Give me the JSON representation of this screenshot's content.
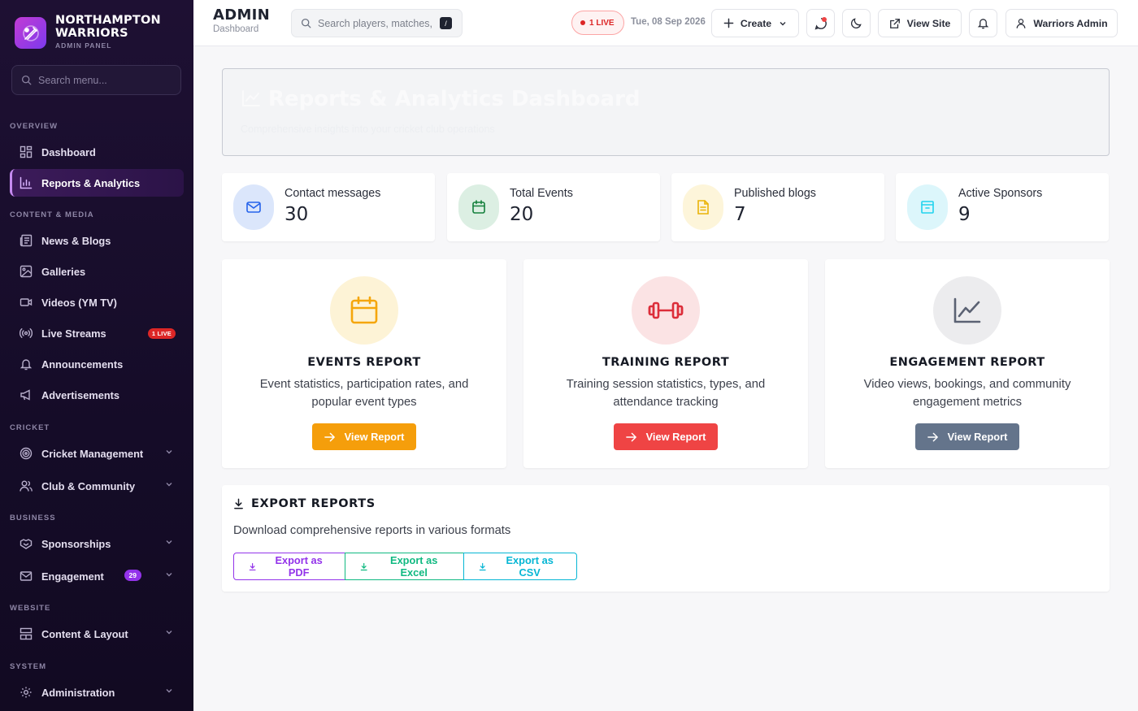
{
  "brand": {
    "title_line1": "NORTHAMPTON",
    "title_line2": "WARRIORS",
    "subtitle": "ADMIN PANEL"
  },
  "sidebar": {
    "search_placeholder": "Search menu...",
    "sections": {
      "overview": "OVERVIEW",
      "content": "CONTENT & MEDIA",
      "cricket": "CRICKET",
      "business": "BUSINESS",
      "website": "WEBSITE",
      "system": "SYSTEM"
    },
    "items": {
      "dashboard": "Dashboard",
      "reports": "Reports & Analytics",
      "news": "News & Blogs",
      "galleries": "Galleries",
      "videos": "Videos (YM TV)",
      "live_streams": "Live Streams",
      "live_badge": "1 LIVE",
      "announcements": "Announcements",
      "advertisements": "Advertisements",
      "cricket_mgmt": "Cricket Management",
      "club": "Club & Community",
      "sponsorships": "Sponsorships",
      "engagement": "Engagement",
      "engagement_badge": "29",
      "content_layout": "Content & Layout",
      "administration": "Administration"
    }
  },
  "topbar": {
    "title": "ADMIN",
    "subtitle": "Dashboard",
    "search_placeholder": "Search players, matches, n",
    "search_shortcut": "/",
    "live_label": "1 LIVE",
    "date": "Tue, 08 Sep 2026",
    "create_label": "Create",
    "view_site_label": "View Site",
    "user_label": "Warriors Admin"
  },
  "hero": {
    "title": "Reports & Analytics Dashboard",
    "subtitle": "Comprehensive insights into your cricket club operations"
  },
  "stats": [
    {
      "label": "Contact messages",
      "value": "30"
    },
    {
      "label": "Total Events",
      "value": "20"
    },
    {
      "label": "Published blogs",
      "value": "7"
    },
    {
      "label": "Active Sponsors",
      "value": "9"
    }
  ],
  "reports": [
    {
      "title": "EVENTS REPORT",
      "description": "Event statistics, participation rates, and popular event types",
      "button": "View Report"
    },
    {
      "title": "TRAINING REPORT",
      "description": "Training session statistics, types, and attendance tracking",
      "button": "View Report"
    },
    {
      "title": "ENGAGEMENT REPORT",
      "description": "Video views, bookings, and community engagement metrics",
      "button": "View Report"
    }
  ],
  "export": {
    "title": "EXPORT REPORTS",
    "description": "Download comprehensive reports in various formats",
    "pdf": "Export as PDF",
    "excel": "Export as Excel",
    "csv": "Export as CSV"
  },
  "colors": {
    "accent_purple": "#9333ea",
    "events_orange": "#f59e0b",
    "training_red": "#ef4444",
    "engagement_slate": "#64748b",
    "excel_green": "#10b981",
    "csv_cyan": "#06b6d4",
    "live_red": "#dc2626"
  }
}
